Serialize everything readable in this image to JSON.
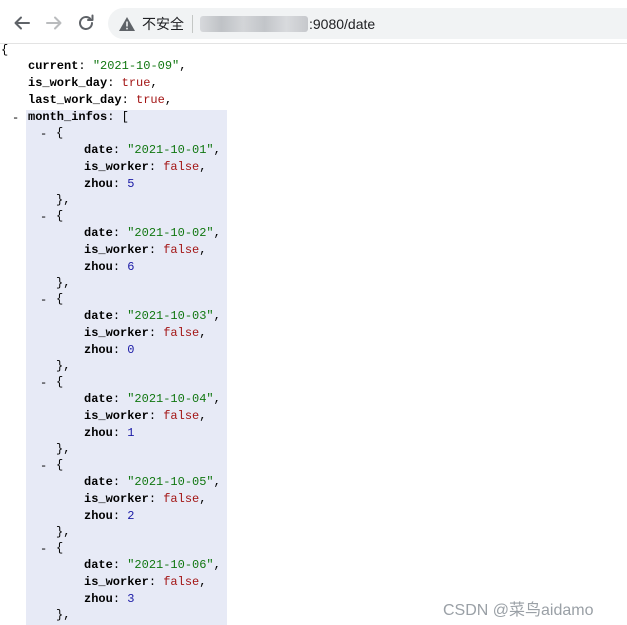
{
  "browser": {
    "security_label": "不安全",
    "url_visible": ":9080/date"
  },
  "json_view": {
    "open_brace": "{",
    "current_key": "current",
    "current_value": "\"2021-10-09\"",
    "is_work_day_key": "is_work_day",
    "is_work_day_value": "true",
    "last_work_day_key": "last_work_day",
    "last_work_day_value": "true",
    "month_infos_key": "month_infos",
    "toggle_symbol": "-",
    "item_open": "{",
    "item_close": "},",
    "date_key": "date",
    "is_worker_key": "is_worker",
    "zhou_key": "zhou",
    "items": [
      {
        "date": "\"2021-10-01\"",
        "is_worker": "false",
        "zhou": "5"
      },
      {
        "date": "\"2021-10-02\"",
        "is_worker": "false",
        "zhou": "6"
      },
      {
        "date": "\"2021-10-03\"",
        "is_worker": "false",
        "zhou": "0"
      },
      {
        "date": "\"2021-10-04\"",
        "is_worker": "false",
        "zhou": "1"
      },
      {
        "date": "\"2021-10-05\"",
        "is_worker": "false",
        "zhou": "2"
      },
      {
        "date": "\"2021-10-06\"",
        "is_worker": "false",
        "zhou": "3"
      }
    ]
  },
  "watermark": "CSDN @菜鸟aidamo"
}
